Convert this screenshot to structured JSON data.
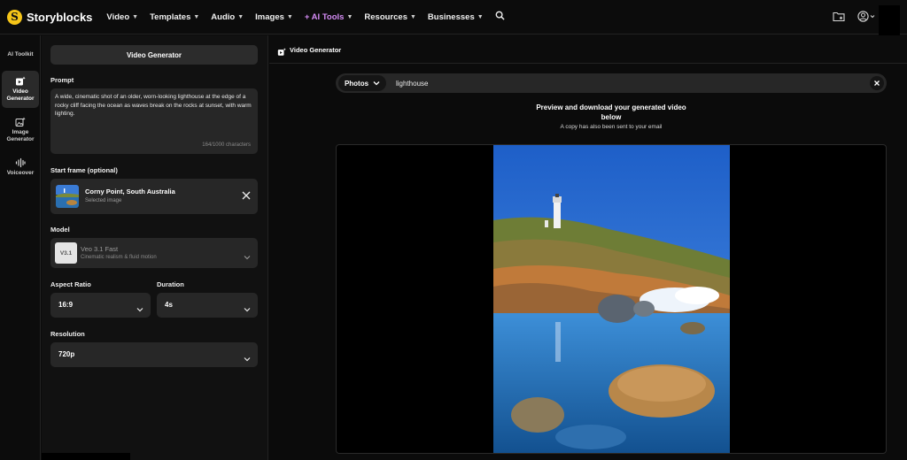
{
  "brand": {
    "name": "Storyblocks",
    "mark": "S"
  },
  "nav": {
    "items": [
      {
        "label": "Video",
        "ai": false
      },
      {
        "label": "Templates",
        "ai": false
      },
      {
        "label": "Audio",
        "ai": false
      },
      {
        "label": "Images",
        "ai": false
      },
      {
        "label": "+ AI Tools",
        "ai": true
      },
      {
        "label": "Resources",
        "ai": false
      },
      {
        "label": "Businesses",
        "ai": false
      }
    ],
    "icons": [
      "search-icon",
      "folder-star-icon",
      "user-icon"
    ]
  },
  "rail": {
    "items": [
      {
        "label": "AI Toolkit",
        "icon": "none",
        "active": false
      },
      {
        "label": "Video Generator",
        "icon": "video-sparkle-icon",
        "active": true
      },
      {
        "label": "Image Generator",
        "icon": "image-sparkle-icon",
        "active": false
      },
      {
        "label": "Voiceover",
        "icon": "waveform-icon",
        "active": false
      }
    ]
  },
  "panel": {
    "generate_button": "Video Generator",
    "prompt_label": "Prompt",
    "prompt_text": "A wide, cinematic shot of an older, worn-looking lighthouse at the edge of a rocky cliff facing the ocean as waves break on the rocks at sunset, with warm lighting.",
    "char_count": "164/1000 characters",
    "start_frame_label": "Start frame (optional)",
    "start_frame_title": "Corny Point, South Australia",
    "start_frame_sub": "Selected image",
    "model_label": "Model",
    "model_badge": "V3.1",
    "model_name": "Veo 3.1 Fast",
    "model_desc": "Cinematic realism & fluid motion",
    "aspect_label": "Aspect Ratio",
    "aspect_value": "16:9",
    "duration_label": "Duration",
    "duration_value": "4s",
    "resolution_label": "Resolution",
    "resolution_value": "720p"
  },
  "main": {
    "header_title": "Video Generator",
    "source_button": "Photos",
    "search_value": "lighthouse",
    "preview_title": "Preview and download your generated video below",
    "preview_sub": "A copy has also been sent to your email"
  },
  "colors": {
    "accent_ai": "#d58cf5",
    "brand_yellow": "#f5c518",
    "panel_bg": "#111111",
    "field_bg": "#272727"
  }
}
